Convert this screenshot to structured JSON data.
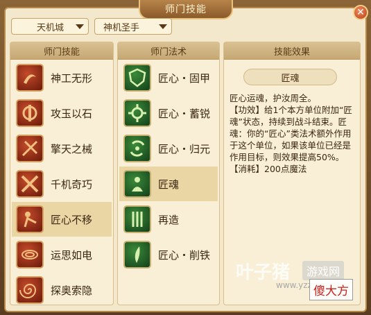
{
  "window": {
    "title": "师门技能",
    "close_label": "✕"
  },
  "dropdowns": {
    "sect": "天机城",
    "branch": "神机圣手"
  },
  "panels": {
    "skills": {
      "header": "师门技能",
      "items": [
        {
          "label": "神工无形",
          "icon": "swirl-hammer-icon"
        },
        {
          "label": "攻玉以石",
          "icon": "jade-cog-icon"
        },
        {
          "label": "擎天之械",
          "icon": "crossed-tools-icon"
        },
        {
          "label": "千机奇巧",
          "icon": "crossed-swords-icon"
        },
        {
          "label": "匠心不移",
          "icon": "figure-tool-icon"
        },
        {
          "label": "运思如电",
          "icon": "vortex-icon"
        },
        {
          "label": "探奥索隐",
          "icon": "spiral-icon"
        }
      ],
      "selected_index": 4
    },
    "spells": {
      "header": "师门法术",
      "items": [
        {
          "label": "匠心・固甲",
          "icon": "shield-icon"
        },
        {
          "label": "匠心・蓄锐",
          "icon": "gears-icon"
        },
        {
          "label": "匠心・归元",
          "icon": "cycle-icon"
        },
        {
          "label": "匠魂",
          "icon": "soul-figure-icon"
        },
        {
          "label": "再造",
          "icon": "rebuild-icon"
        },
        {
          "label": "匠心・削铁",
          "icon": "blade-icon"
        }
      ],
      "selected_index": 3
    },
    "effect": {
      "header": "技能效果",
      "name": "匠魂",
      "lines": [
        "匠心运魂，护汝周全。",
        "【功效】给1个本方单位附加“匠魂”状态，持续到战斗结束。匠魂：你的“匠心”类法术额外作用于这个单位，如果该单位已经是作用目标，则效果提高50%。",
        "【消耗】200点魔法"
      ]
    }
  },
  "watermark": {
    "brand": "叶子猪",
    "site_label": "游戏网",
    "url": "www.yzz.cn",
    "badge": "傻大方"
  },
  "colors": {
    "selected_row": "#ead6a4",
    "panel_bg": "#f8efd6",
    "close_red": "#c8461e"
  }
}
